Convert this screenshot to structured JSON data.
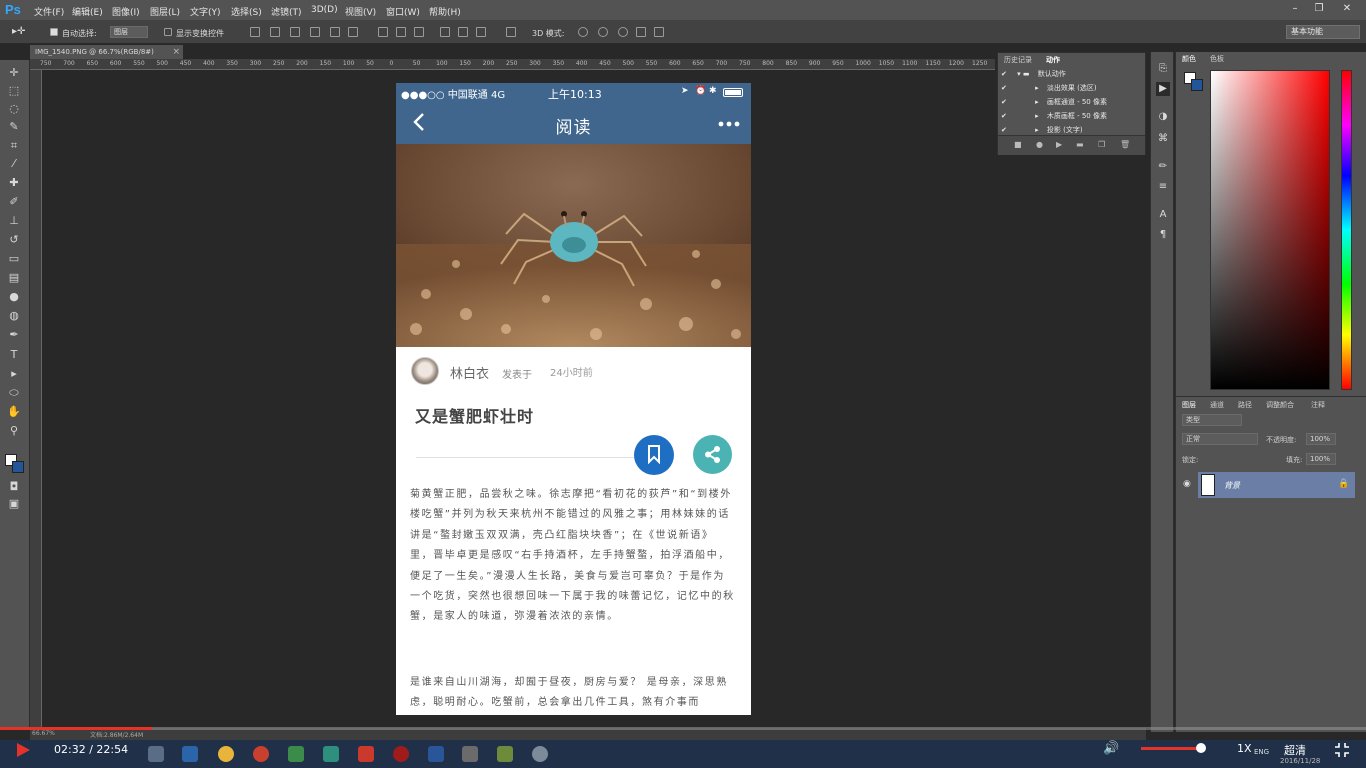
{
  "app": {
    "logo": "Ps"
  },
  "menu": [
    "文件(F)",
    "编辑(E)",
    "图像(I)",
    "图层(L)",
    "文字(Y)",
    "选择(S)",
    "滤镜(T)",
    "3D(D)",
    "视图(V)",
    "窗口(W)",
    "帮助(H)"
  ],
  "options": {
    "auto_select_label": "自动选择:",
    "auto_select_value": "图层",
    "show_transform_label": "显示变换控件",
    "mode_3d_label": "3D 模式:",
    "workspace": "基本功能"
  },
  "document": {
    "tab_title": "IMG_1540.PNG @ 66.7%(RGB/8#)",
    "zoom": "66.67%",
    "doc_size": "文档:2.86M/2.64M",
    "ruler_labels": [
      "750",
      "700",
      "650",
      "600",
      "550",
      "500",
      "450",
      "400",
      "350",
      "300",
      "250",
      "200",
      "150",
      "100",
      "50",
      "0",
      "50",
      "100",
      "150",
      "200",
      "250",
      "300",
      "350",
      "400",
      "450",
      "500",
      "550",
      "600",
      "650",
      "700",
      "750",
      "800",
      "850",
      "900",
      "950",
      "1000",
      "1050",
      "1100",
      "1150",
      "1200",
      "1250"
    ]
  },
  "phone": {
    "status": {
      "carrier": "●●●○○ 中国联通  4G",
      "time": "上午10:13"
    },
    "nav_title": "阅读",
    "author": "林白衣",
    "posted_label": "发表于",
    "time_ago": "24小时前",
    "title": "又是蟹肥虾壮时",
    "paragraphs": [
      "菊黄蟹正肥，品尝秋之味。徐志摩把“看初花的荻芦”和“到楼外楼吃蟹”并列为秋天来杭州不能错过的风雅之事；用林妹妹的话讲是“螯封嫩玉双双满，壳凸红脂块块香”；在《世说新语》里，晋毕卓更是感叹“右手持酒杯，左手持蟹螯，拍浮酒船中，便足了一生矣。”漫漫人生长路，美食与爱岂可辜负？于是作为一个吃货，突然也很想回味一下属于我的味蕾记忆，记忆中的秋蟹，是家人的味道，弥漫着浓浓的亲情。",
      "是谁来自山川湖海，却囿于昼夜，厨房与爱？ 是母亲，深思熟虑，聪明耐心。吃蟹前，总会拿出几件工具，煞有介事而"
    ]
  },
  "history_panel": {
    "tabs": [
      "历史记录",
      "动作"
    ],
    "rows": [
      "默认动作",
      "淡出效果 (选区)",
      "画框通道 - 50 像素",
      "木质画框 - 50 像素",
      "投影 (文字)"
    ]
  },
  "color_panel": {
    "tabs": [
      "颜色",
      "色板"
    ]
  },
  "layers_panel": {
    "tabs": [
      "图层",
      "通道",
      "路径",
      "调整颜合",
      "注释"
    ],
    "kind": "类型",
    "blend": "正常",
    "opacity_label": "不透明度:",
    "opacity_value": "100%",
    "lock_label": "锁定:",
    "fill_label": "填充:",
    "fill_value": "100%",
    "layer_name": "背景"
  },
  "player": {
    "time": "02:32 / 22:54",
    "speed": "1X",
    "quality": "超清",
    "lang": "ENG",
    "date": "2016/11/28"
  },
  "colors": {
    "ps_blue": "#31a8ff",
    "phone_header": "#40668e",
    "bookmark": "#1e6ec4",
    "share": "#4bb3b3",
    "progress": "#e5332a"
  }
}
